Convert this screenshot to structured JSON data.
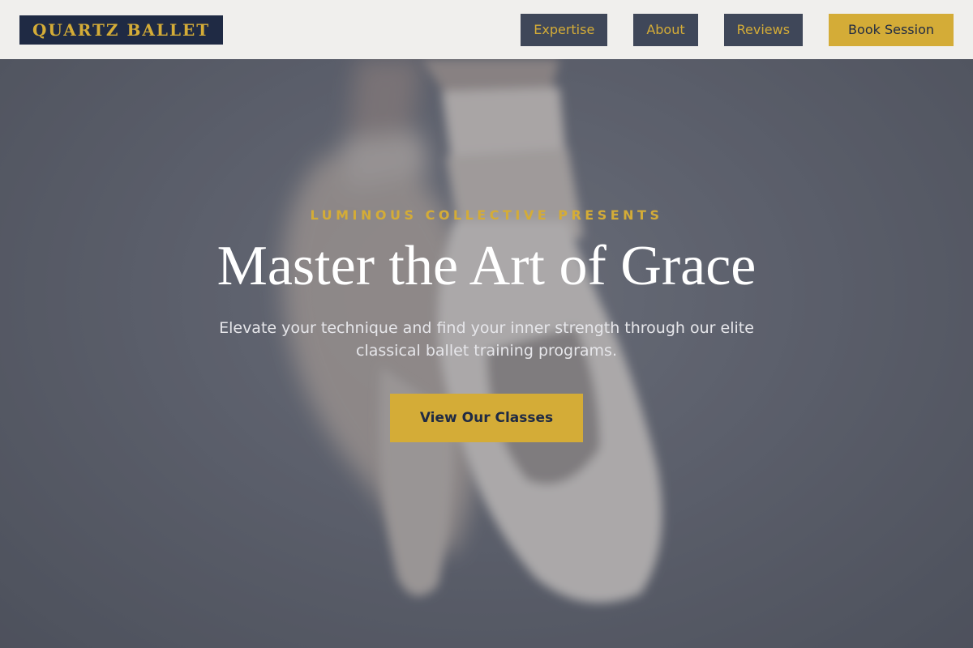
{
  "header": {
    "logo": "QUARTZ BALLET",
    "nav": [
      {
        "label": "Expertise"
      },
      {
        "label": "About"
      },
      {
        "label": "Reviews"
      }
    ],
    "cta_label": "Book Session"
  },
  "hero": {
    "eyebrow": "LUMINOUS COLLECTIVE PRESENTS",
    "title": "Master the Art of Grace",
    "subtitle": "Elevate your technique and find your inner strength through our elite classical ballet training programs.",
    "button_label": "View Our Classes",
    "background_image": "ballet-pointe-shoes-photo"
  },
  "colors": {
    "brand_navy": "#1f2a44",
    "brand_gold": "#d4ac37",
    "nav_button_bg": "#3f4759",
    "header_bg": "#f0efed"
  }
}
